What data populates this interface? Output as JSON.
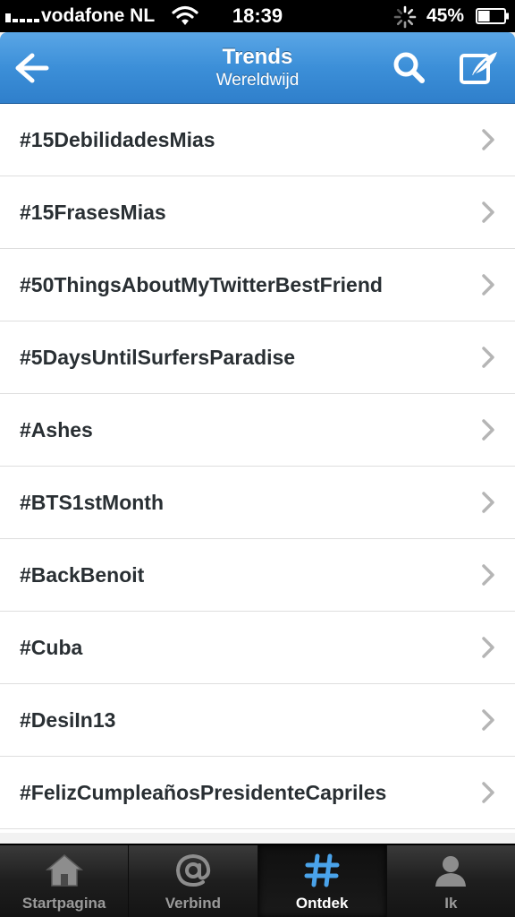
{
  "status_bar": {
    "carrier": "vodafone NL",
    "time": "18:39",
    "battery": "45%",
    "battery_level": 0.45
  },
  "nav": {
    "title": "Trends",
    "subtitle": "Wereldwijd",
    "icons": {
      "back": "back-arrow-icon",
      "search": "search-icon",
      "compose": "compose-icon"
    }
  },
  "trends": [
    {
      "label": "#15DebilidadesMias"
    },
    {
      "label": "#15FrasesMias"
    },
    {
      "label": "#50ThingsAboutMyTwitterBestFriend"
    },
    {
      "label": "#5DaysUntilSurfersParadise"
    },
    {
      "label": "#Ashes"
    },
    {
      "label": "#BTS1stMonth"
    },
    {
      "label": "#BackBenoit"
    },
    {
      "label": "#Cuba"
    },
    {
      "label": "#DesiIn13"
    },
    {
      "label": "#FelizCumpleañosPresidenteCapriles"
    }
  ],
  "tabs": [
    {
      "label": "Startpagina",
      "icon": "home-icon",
      "active": false
    },
    {
      "label": "Verbind",
      "icon": "at-icon",
      "active": false
    },
    {
      "label": "Ontdek",
      "icon": "hashtag-icon",
      "active": true
    },
    {
      "label": "Ik",
      "icon": "person-icon",
      "active": false
    }
  ],
  "colors": {
    "nav_blue": "#3c8fd8",
    "active_tab_icon": "#4aa3ea",
    "text_dark": "#292f33"
  }
}
